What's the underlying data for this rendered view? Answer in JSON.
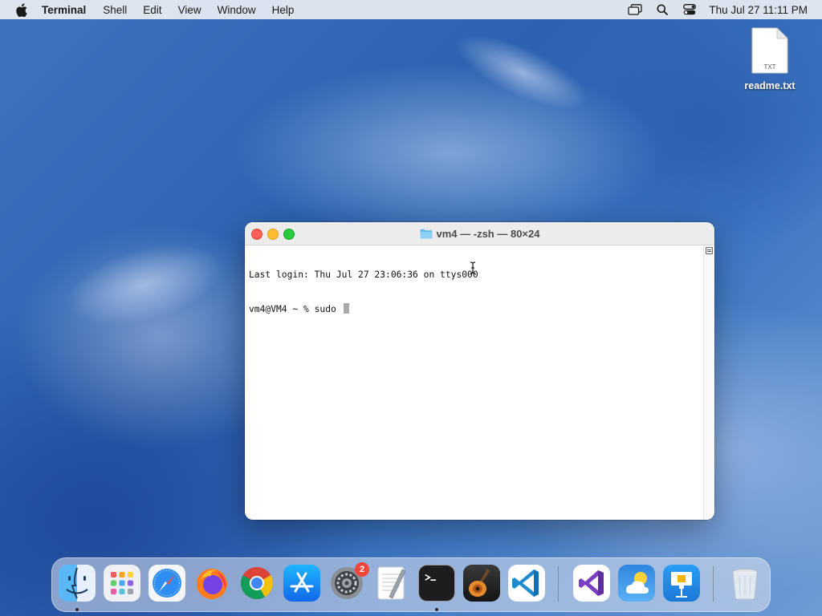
{
  "menubar": {
    "apple_icon": "apple-icon",
    "app_name": "Terminal",
    "items": [
      "Shell",
      "Edit",
      "View",
      "Window",
      "Help"
    ],
    "status_icons": [
      "screen-mirroring-icon",
      "search-icon",
      "control-center-icon"
    ],
    "clock": "Thu Jul 27  11:11 PM"
  },
  "desktop": {
    "file": {
      "name": "readme.txt",
      "icon_text": "TXT",
      "icon": "text-file-icon"
    }
  },
  "terminal": {
    "title": "vm4 — -zsh — 80×24",
    "title_icon": "folder-icon",
    "lines": [
      "Last login: Thu Jul 27 23:06:36 on ttys000",
      "vm4@VM4 ~ % sudo "
    ]
  },
  "dock": {
    "apps": [
      {
        "name": "Finder",
        "icon": "finder-icon",
        "running": true
      },
      {
        "name": "Launchpad",
        "icon": "launchpad-icon",
        "running": false
      },
      {
        "name": "Safari",
        "icon": "safari-icon",
        "running": false
      },
      {
        "name": "Firefox",
        "icon": "firefox-icon",
        "running": false
      },
      {
        "name": "Google Chrome",
        "icon": "chrome-icon",
        "running": false
      },
      {
        "name": "App Store",
        "icon": "app-store-icon",
        "running": false
      },
      {
        "name": "System Settings",
        "icon": "system-settings-icon",
        "running": false,
        "badge": "2"
      },
      {
        "name": "TextEdit",
        "icon": "textedit-icon",
        "running": false
      },
      {
        "name": "Terminal",
        "icon": "terminal-icon",
        "running": true
      },
      {
        "name": "GarageBand",
        "icon": "garageband-icon",
        "running": false
      },
      {
        "name": "Visual Studio Code",
        "icon": "vscode-icon",
        "running": false
      },
      {
        "name": "Visual Studio",
        "icon": "visual-studio-icon",
        "running": false
      },
      {
        "name": "Weather",
        "icon": "weather-icon",
        "running": false
      },
      {
        "name": "Keynote",
        "icon": "keynote-icon",
        "running": false
      },
      {
        "name": "Trash",
        "icon": "trash-icon",
        "running": false
      }
    ]
  },
  "colors": {
    "close": "#ff5f57",
    "minimize": "#febc2e",
    "maximize": "#28c840",
    "badge": "#f0473c"
  }
}
